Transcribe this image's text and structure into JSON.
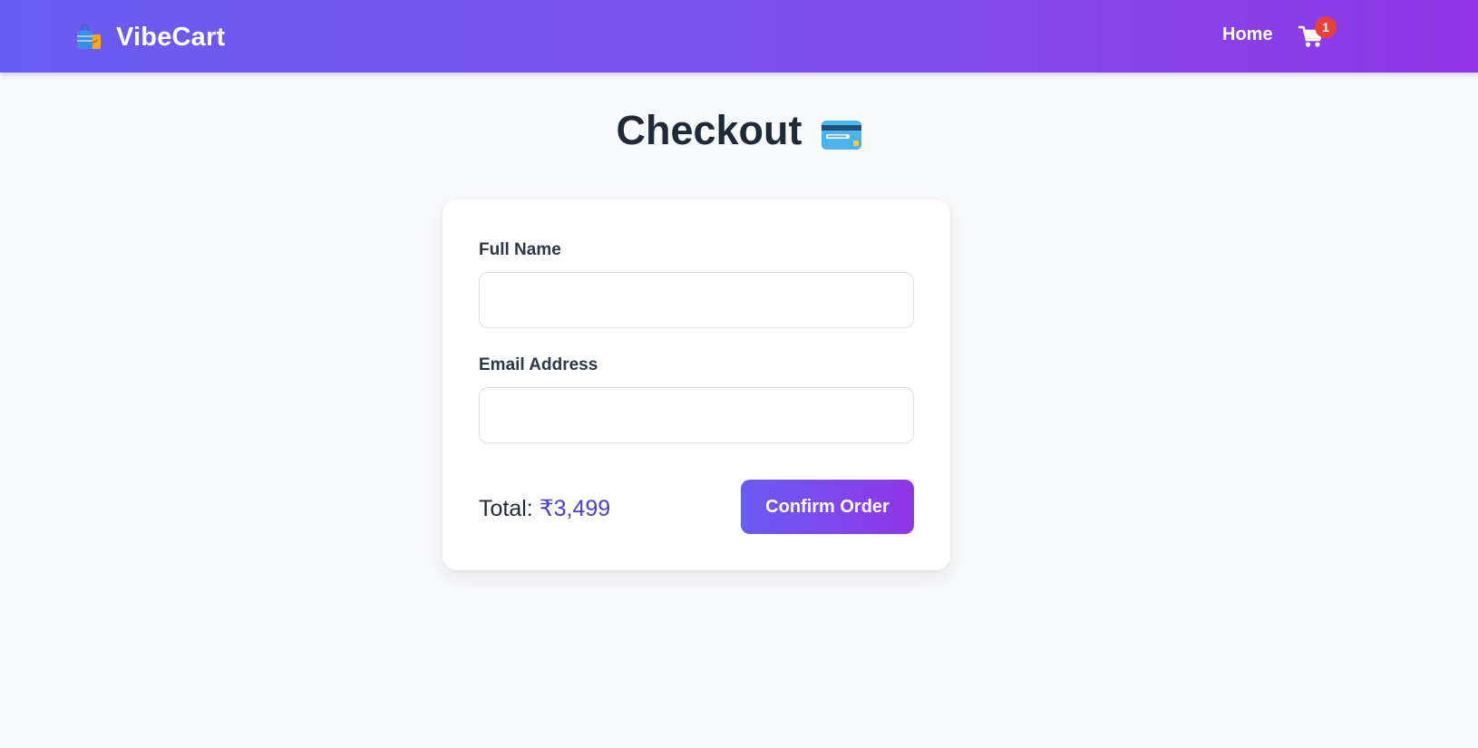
{
  "header": {
    "brand_icon": "shopping-bags-icon",
    "brand_name": "VibeCart",
    "nav_home": "Home",
    "cart_icon": "shopping-cart-icon",
    "cart_count": "1"
  },
  "page": {
    "title": "Checkout",
    "title_icon": "credit-card-icon"
  },
  "form": {
    "full_name_label": "Full Name",
    "full_name_value": "",
    "email_label": "Email Address",
    "email_value": "",
    "total_label": "Total:",
    "total_amount": "₹3,499",
    "confirm_label": "Confirm Order"
  },
  "colors": {
    "header_gradient_start": "#6a5cf2",
    "header_gradient_end": "#9036e6",
    "total_amount": "#4c3fcf",
    "badge": "#e8413c",
    "background": "#f8f9fb"
  }
}
